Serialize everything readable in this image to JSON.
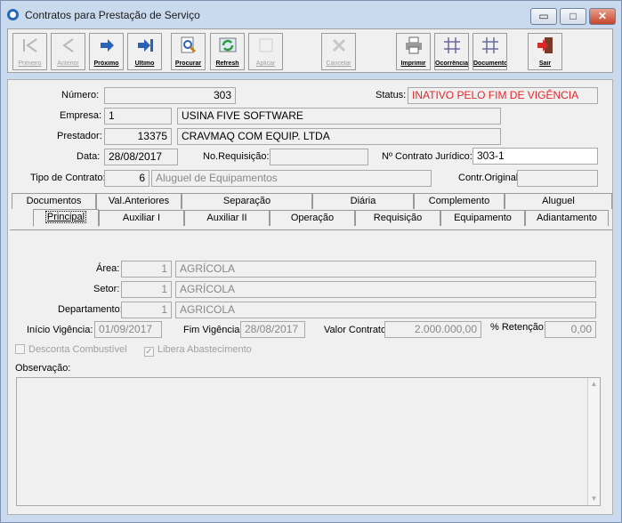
{
  "window": {
    "title": "Contratos para Prestação de Serviço"
  },
  "titlebar_buttons": {
    "minimize": "▭",
    "maximize": "□",
    "close": "✕"
  },
  "toolbar": [
    {
      "label": "Primeiro",
      "icon": "first-icon",
      "enabled": false
    },
    {
      "label": "Anterior",
      "icon": "prev-icon",
      "enabled": false
    },
    {
      "label": "Próximo",
      "icon": "next-icon",
      "enabled": true
    },
    {
      "label": "Último",
      "icon": "last-icon",
      "enabled": true
    },
    {
      "label": "Procurar",
      "icon": "search-icon",
      "enabled": true
    },
    {
      "label": "Refresh",
      "icon": "refresh-icon",
      "enabled": true
    },
    {
      "label": "Aplicar",
      "icon": "apply-icon",
      "enabled": false
    },
    {
      "label": "Cancelar",
      "icon": "cancel-icon",
      "enabled": false
    },
    {
      "label": "Imprimir",
      "icon": "printer-icon",
      "enabled": true
    },
    {
      "label": "Ocorrência",
      "icon": "grid-icon",
      "enabled": true
    },
    {
      "label": "Documento",
      "icon": "grid-icon",
      "enabled": true
    },
    {
      "label": "Sair",
      "icon": "exit-door-icon",
      "enabled": true
    }
  ],
  "header": {
    "numero_label": "Número:",
    "numero": "303",
    "status_label": "Status:",
    "status": "INATIVO PELO FIM DE VIGÊNCIA",
    "empresa_label": "Empresa:",
    "empresa_code": "1",
    "empresa_name": "USINA FIVE SOFTWARE",
    "prestador_label": "Prestador:",
    "prestador_code": "13375",
    "prestador_name": "CRAVMAQ COM EQUIP. LTDA",
    "data_label": "Data:",
    "data": "28/08/2017",
    "requisicao_label": "No.Requisição:",
    "requisicao": "",
    "juridico_label": "Nº Contrato Jurídico:",
    "juridico": "303-1",
    "tipo_label": "Tipo de Contrato:",
    "tipo_code": "6",
    "tipo_name": "Aluguel de Equipamentos",
    "original_label": "Contr.Original:",
    "original": ""
  },
  "tabs_row1": [
    "Documentos",
    "Val.Anteriores",
    "Separação",
    "Diária",
    "Complemento",
    "Aluguel"
  ],
  "tabs_row2": [
    "Principal",
    "Auxiliar I",
    "Auxiliar II",
    "Operação",
    "Requisição",
    "Equipamento",
    "Adiantamento"
  ],
  "principal": {
    "area_label": "Área:",
    "area_code": "1",
    "area_name": "AGRÍCOLA",
    "setor_label": "Setor:",
    "setor_code": "1",
    "setor_name": "AGRÍCOLA",
    "depto_label": "Departamento:",
    "depto_code": "1",
    "depto_name": "AGRICOLA",
    "inicio_label": "Início Vigência:",
    "inicio": "01/09/2017",
    "fim_label": "Fim Vigência:",
    "fim": "28/08/2017",
    "valor_label": "Valor Contrato:",
    "valor": "2.000.000,00",
    "retencao_label": "% Retenção:",
    "retencao": "0,00",
    "desconta_label": "Desconta Combustível",
    "desconta_checked": false,
    "libera_label": "Libera Abastecimento",
    "libera_checked": true,
    "obs_label": "Observação:",
    "obs": ""
  },
  "colors": {
    "status_red": "#e3262b",
    "toolbar_blue": "#2a62b4",
    "exit_red": "#d62a2a"
  }
}
